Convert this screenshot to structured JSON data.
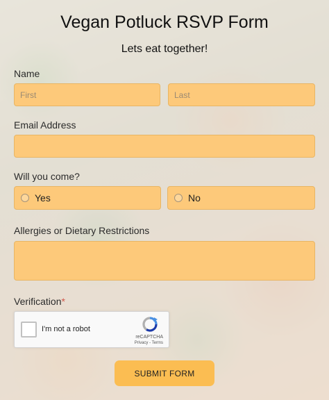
{
  "header": {
    "title": "Vegan Potluck RSVP Form",
    "subtitle": "Lets eat together!"
  },
  "name_field": {
    "label": "Name",
    "first_placeholder": "First",
    "last_placeholder": "Last",
    "first_value": "",
    "last_value": ""
  },
  "email_field": {
    "label": "Email Address",
    "value": ""
  },
  "attendance": {
    "label": "Will you come?",
    "options": [
      {
        "label": "Yes",
        "selected": false
      },
      {
        "label": "No",
        "selected": false
      }
    ]
  },
  "allergies_field": {
    "label": "Allergies or Dietary Restrictions",
    "value": ""
  },
  "verification": {
    "label": "Verification",
    "required_marker": "*",
    "checkbox_label": "I'm not a robot",
    "brand": "reCAPTCHA",
    "links": "Privacy - Terms"
  },
  "submit": {
    "label": "SUBMIT FORM"
  },
  "colors": {
    "field_fill": "#fdc97a",
    "submit_fill": "#fbbd52",
    "required_star": "#d0574a"
  }
}
